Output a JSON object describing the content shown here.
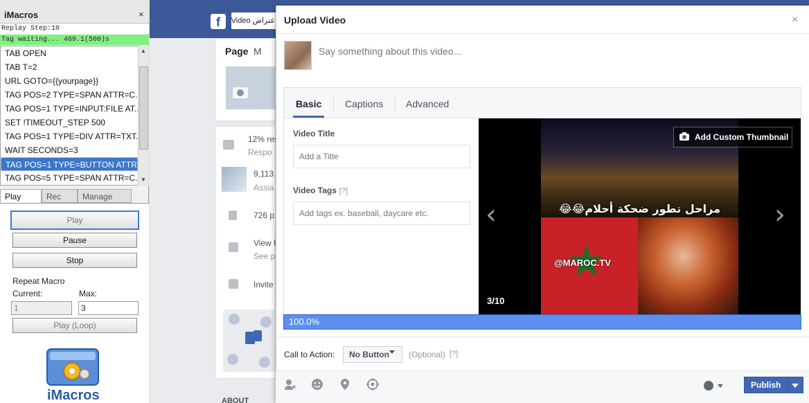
{
  "imacros": {
    "title": "iMacros",
    "close": "×",
    "status_replay": "Replay Step:10",
    "status_tag": "Tag waiting... 469.1(500)s",
    "script_lines": [
      "TAB OPEN",
      "TAB T=2",
      "URL GOTO={{yourpage}}",
      "TAG POS=2 TYPE=SPAN ATTR=C...",
      "TAG POS=1 TYPE=INPUT:FILE AT...",
      "SET !TIMEOUT_STEP 500",
      "TAG POS=1 TYPE=DIV ATTR=TXT...",
      "WAIT SECONDS=3",
      "TAG POS=1 TYPE=BUTTON ATTR...",
      "TAG POS=5 TYPE=SPAN ATTR=C..."
    ],
    "selected_line": 8,
    "tabs": [
      "Play",
      "Rec",
      "Manage"
    ],
    "active_tab": "Play",
    "buttons": {
      "play": "Play",
      "pause": "Pause",
      "stop": "Stop",
      "play_loop": "Play (Loop)"
    },
    "repeat_label": "Repeat Macro",
    "current_label": "Current:",
    "current_value": "1",
    "max_label": "Max:",
    "max_value": "3",
    "logo_text": "iMacros"
  },
  "facebook": {
    "logo": "f",
    "search_text": "اعتراض Video",
    "page_tab": "Page",
    "page_tab2": "M",
    "stat1_pct": "12% res",
    "stat1_sub": "Respo",
    "stat2_num": "9,113",
    "stat2_sub": "Assia",
    "stat3": "726 p",
    "stat4": "View P",
    "stat4_sub": "See p",
    "stat5": "Invite f",
    "about": "ABOUT"
  },
  "dialog": {
    "title": "Upload Video",
    "close": "×",
    "say_placeholder": "Say something about this video...",
    "tabs": [
      "Basic",
      "Captions",
      "Advanced"
    ],
    "active_tab": "Basic",
    "video_title_label": "Video Title",
    "title_placeholder": "Add a Title",
    "video_tags_label": "Video Tags",
    "tags_help": "[?]",
    "tags_placeholder": "Add tags ex. baseball, daycare etc.",
    "thumbnail_button": "Add Custom Thumbnail",
    "thumbnail_arabic": "مراحل تطور ضحكة أحلام😂😂",
    "thumbnail_handle": "@MAROC.TV",
    "thumbnail_counter": "3/10",
    "prev": "‹",
    "next": "›",
    "progress_text": "100.0%",
    "progress_value": 1.0,
    "cta_label": "Call to Action:",
    "cta_value": "No Button",
    "cta_optional": "(Optional)",
    "cta_help": "[?]",
    "publish": "Publish",
    "footer_icons": [
      "tag-people-icon",
      "feeling-icon",
      "location-icon",
      "target-icon"
    ],
    "colors": {
      "primary": "#4267b2",
      "progress": "#5b8ff0",
      "fb_blue": "#3b5998"
    }
  }
}
